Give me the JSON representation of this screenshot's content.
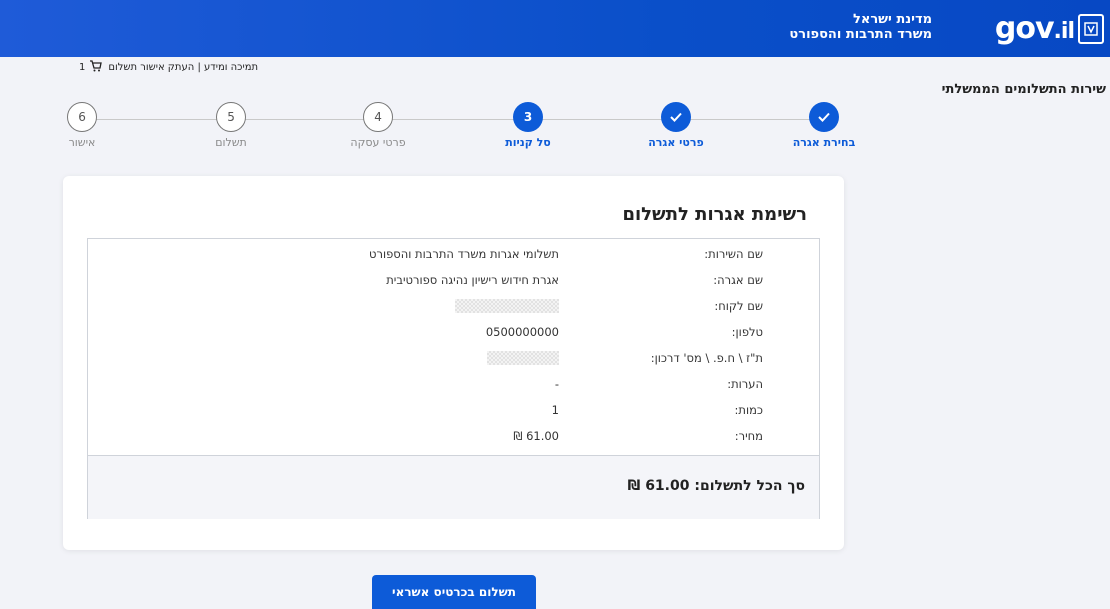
{
  "header": {
    "logo_text": "gov",
    "logo_suffix": ".il",
    "state_name": "מדינת ישראל",
    "ministry_name": "משרד התרבות והספורט"
  },
  "support": {
    "links": "תמיכה ומידע | העתק אישור תשלום",
    "cart_count": "1"
  },
  "service_title": "שירות התשלומים הממשלתי",
  "steps": [
    {
      "num": "1",
      "label": "בחירת אגרה",
      "state": "done"
    },
    {
      "num": "2",
      "label": "פרטי אגרה",
      "state": "done"
    },
    {
      "num": "3",
      "label": "סל קניות",
      "state": "current"
    },
    {
      "num": "4",
      "label": "פרטי עסקה",
      "state": "todo"
    },
    {
      "num": "5",
      "label": "תשלום",
      "state": "todo"
    },
    {
      "num": "6",
      "label": "אישור",
      "state": "todo"
    }
  ],
  "card": {
    "title": "רשימת אגרות לתשלום",
    "rows": [
      {
        "label": "שם השירות:",
        "value": "תשלומי אגרות משרד התרבות והספורט"
      },
      {
        "label": "שם אגרה:",
        "value": "אגרת חידוש רישיון נהיגה ספורטיבית"
      },
      {
        "label": "שם לקוח:",
        "value": ""
      },
      {
        "label": "טלפון:",
        "value": "0500000000"
      },
      {
        "label": "ת\"ז \\ ח.פ. \\ מס' דרכון:",
        "value": ""
      },
      {
        "label": "הערות:",
        "value": "-"
      },
      {
        "label": "כמות:",
        "value": "1"
      },
      {
        "label": "מחיר:",
        "value": "61.00 ₪"
      }
    ],
    "total": "סך הכל לתשלום: 61.00 ₪"
  },
  "pay_button": "תשלום בכרטיס אשראי",
  "colors": {
    "primary": "#0d5bd8",
    "header": "#0a4fc9",
    "background": "#f2f3f8"
  }
}
